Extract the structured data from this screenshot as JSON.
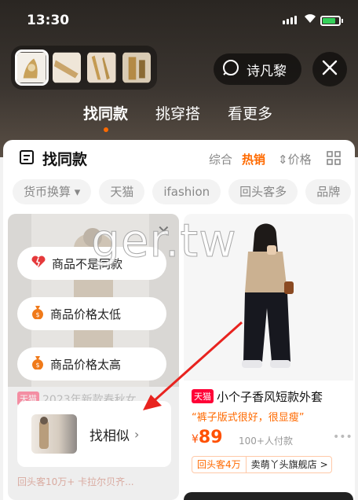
{
  "status_bar": {
    "time": "13:30"
  },
  "header": {
    "search_label": "诗凡黎",
    "tabs": [
      {
        "label": "找同款",
        "active": true
      },
      {
        "label": "挑穿搭",
        "active": false
      },
      {
        "label": "看更多",
        "active": false
      }
    ]
  },
  "sheet": {
    "title": "找同款",
    "sort": {
      "comprehensive": "综合",
      "hot": "热销",
      "price": "价格"
    },
    "filters": [
      "货币换算",
      "天猫",
      "ifashion",
      "回头客多",
      "品牌"
    ]
  },
  "left_card": {
    "feedback": [
      "商品不是同款",
      "商品价格太低",
      "商品价格太高"
    ],
    "find_similar": "找相似",
    "dim_title": "2023年新款春秋女",
    "dim_title_tag": "天猫",
    "dim_shop": "回头客10万+ 卡拉尔贝齐..."
  },
  "right_card": {
    "tag": "天猫",
    "title": "小个子香风短款外套",
    "quote": "“裤子版式很好，很显瘦”",
    "price_currency": "¥",
    "price": "89",
    "sales": "100+人付款",
    "returning": "回头客4万",
    "shop": "卖萌丫头旗舰店",
    "shop_chevron": ">"
  },
  "watermark": "ger.tw",
  "colors": {
    "accent": "#ff6a00",
    "tmall": "#ff0036",
    "arrow": "#e8231f"
  }
}
